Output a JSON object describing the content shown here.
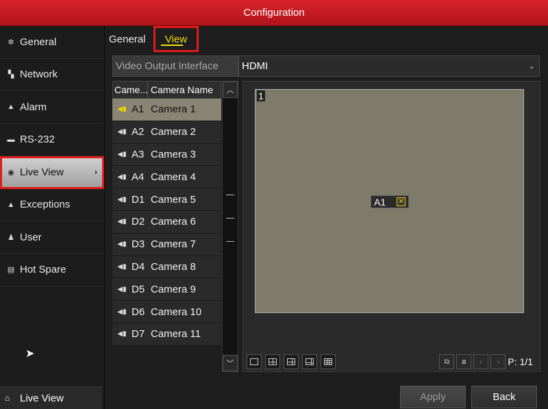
{
  "window": {
    "title": "Configuration"
  },
  "sidebar": {
    "items": [
      {
        "label": "General",
        "icon": "gear-icon"
      },
      {
        "label": "Network",
        "icon": "network-icon"
      },
      {
        "label": "Alarm",
        "icon": "alarm-icon"
      },
      {
        "label": "RS-232",
        "icon": "rs232-icon"
      },
      {
        "label": "Live View",
        "icon": "eye-icon",
        "active": true
      },
      {
        "label": "Exceptions",
        "icon": "warning-icon"
      },
      {
        "label": "User",
        "icon": "users-icon"
      },
      {
        "label": "Hot Spare",
        "icon": "hot-spare-icon"
      }
    ],
    "bottom_label": "Live View"
  },
  "tabs": {
    "general": "General",
    "view": "View"
  },
  "video_output": {
    "label": "Video Output Interface",
    "value": "HDMI"
  },
  "camera_table": {
    "headers": [
      "Came...",
      "Camera Name"
    ],
    "rows": [
      {
        "id": "A1",
        "name": "Camera 1"
      },
      {
        "id": "A2",
        "name": "Camera 2"
      },
      {
        "id": "A3",
        "name": "Camera 3"
      },
      {
        "id": "A4",
        "name": "Camera 4"
      },
      {
        "id": "D1",
        "name": "Camera 5"
      },
      {
        "id": "D2",
        "name": "Camera 6"
      },
      {
        "id": "D3",
        "name": "Camera 7"
      },
      {
        "id": "D4",
        "name": "Camera 8"
      },
      {
        "id": "D5",
        "name": "Camera 9"
      },
      {
        "id": "D6",
        "name": "Camera 10"
      },
      {
        "id": "D7",
        "name": "Camera 11"
      }
    ]
  },
  "preview": {
    "window_number": "1",
    "assigned_camera": "A1",
    "page": "P: 1/1"
  },
  "buttons": {
    "apply": "Apply",
    "back": "Back"
  },
  "colors": {
    "title_red": "#c81b22",
    "highlight_yellow": "#f7df10",
    "preview_bg": "#7e7b6b"
  }
}
